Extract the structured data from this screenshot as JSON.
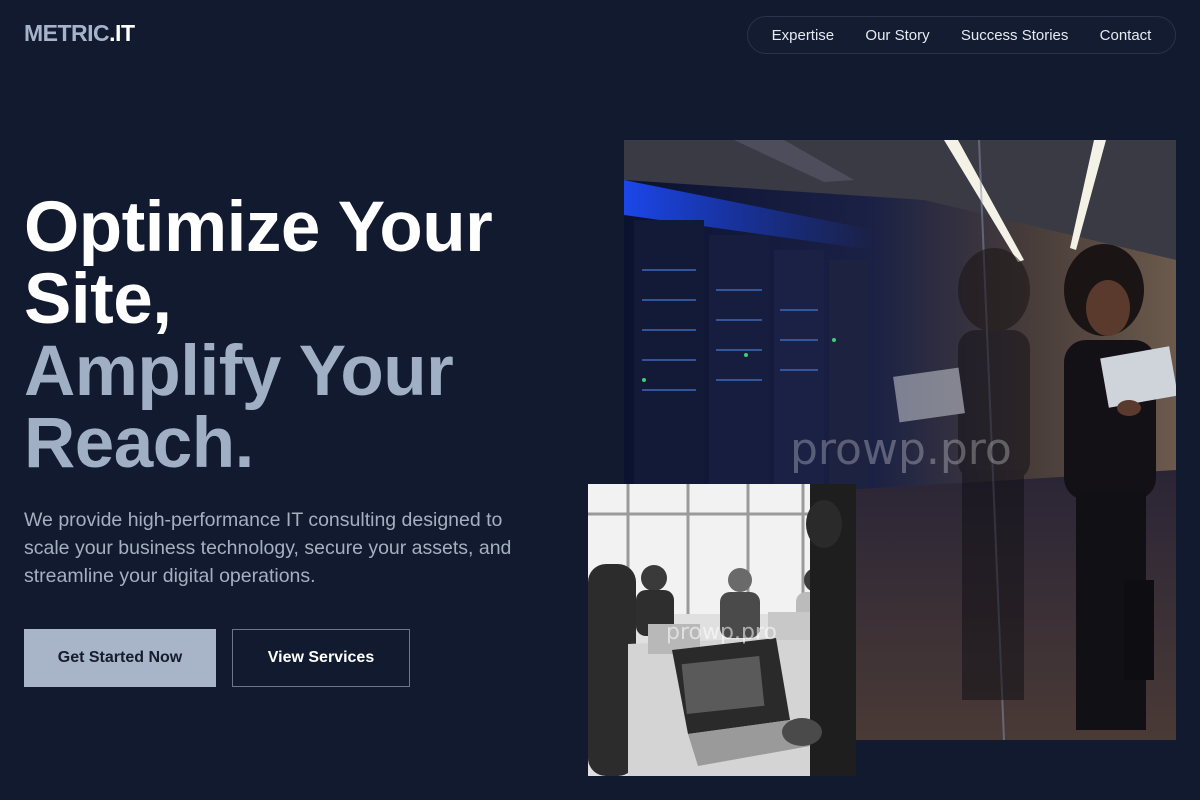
{
  "header": {
    "logo_part1": "METRIC",
    "logo_part2": ".IT",
    "nav": [
      {
        "label": "Expertise"
      },
      {
        "label": "Our Story"
      },
      {
        "label": "Success Stories"
      },
      {
        "label": "Contact"
      }
    ]
  },
  "hero": {
    "headline_line1": "Optimize Your Site,",
    "headline_line2": "Amplify Your Reach.",
    "description": "We provide high-performance IT consulting designed to scale your business technology, secure your assets, and streamline your digital operations.",
    "primary_button": "Get Started Now",
    "secondary_button": "View Services"
  },
  "images": {
    "main_watermark": "prowp.pro",
    "secondary_watermark": "prowp.pro"
  },
  "colors": {
    "background": "#111a2e",
    "accent": "#a8b4c8",
    "muted_text": "#a4b0c2"
  }
}
